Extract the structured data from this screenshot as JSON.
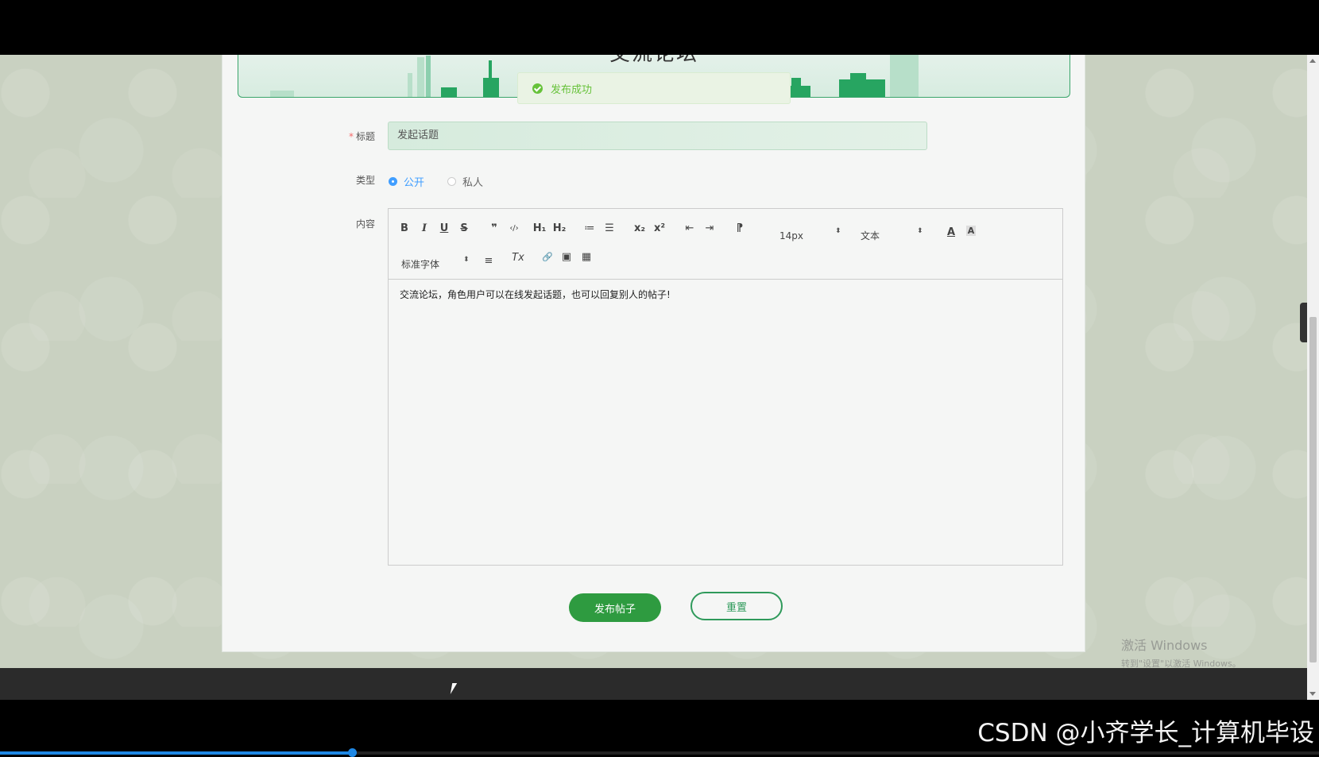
{
  "banner": {
    "title": "交流论坛"
  },
  "toast": {
    "message": "发布成功",
    "icon": "check-circle-icon",
    "color": "#67c23a"
  },
  "form": {
    "title_label": "标题",
    "required_mark": "*",
    "title_value": "发起话题",
    "type_label": "类型",
    "type_options": [
      "公开",
      "私人"
    ],
    "type_selected": "公开",
    "content_label": "内容"
  },
  "editor": {
    "toolbar": {
      "bold": "B",
      "italic": "I",
      "underline": "U",
      "strike": "S",
      "quote": "❞",
      "code": "‹/›",
      "h1": "H₁",
      "h2": "H₂",
      "ordered_list": "≔",
      "bullet_list": "☰",
      "subscript": "x₂",
      "superscript": "x²",
      "outdent": "⇤",
      "indent": "⇥",
      "direction": "⁋",
      "size": "14px",
      "header": "文本",
      "color": "A",
      "background": "A",
      "font": "标准字体",
      "align": "≡",
      "clean": "Tx",
      "link": "🔗",
      "image": "▣",
      "video": "▦",
      "caret": "⬍"
    },
    "content": "交流论坛，角色用户可以在线发起话题，也可以回复别人的帖子!"
  },
  "buttons": {
    "submit": "发布帖子",
    "reset": "重置"
  },
  "side_tab": {
    "icon": "chevron-right-icon",
    "glyph": "›"
  },
  "watermark": {
    "line1": "激活 Windows",
    "line2": "转到\"设置\"以激活 Windows。"
  },
  "overlay": {
    "csdn": "CSDN @小齐学长_计算机毕设"
  },
  "video_progress": {
    "fraction": 0.267
  },
  "colors": {
    "primary": "#2e9b40",
    "accent": "#409eff",
    "banner_border": "#3aa56b"
  }
}
